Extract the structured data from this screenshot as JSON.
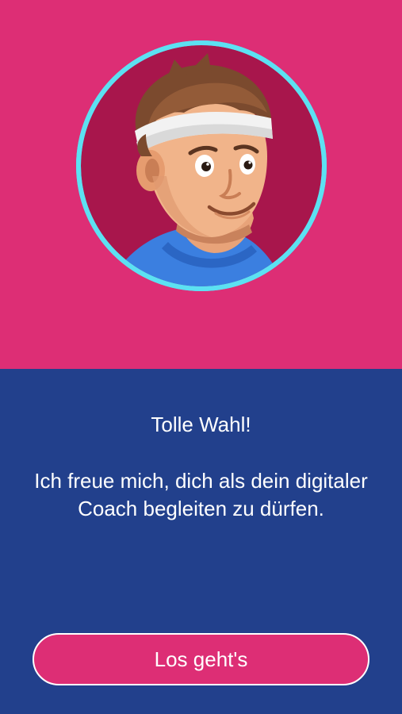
{
  "coach": {
    "avatar_icon": "coach-avatar-icon",
    "ring_color": "#5CE1F2",
    "background_color": "#A8164C"
  },
  "welcome": {
    "headline": "Tolle Wahl!",
    "message": "Ich freue mich, dich als dein digitaler Coach begleiten zu dürfen."
  },
  "actions": {
    "start_label": "Los geht's"
  },
  "colors": {
    "top_background": "#DD2E75",
    "bottom_background": "#22408C",
    "button_fill": "#DD2E75",
    "text": "#FFFFFF"
  }
}
